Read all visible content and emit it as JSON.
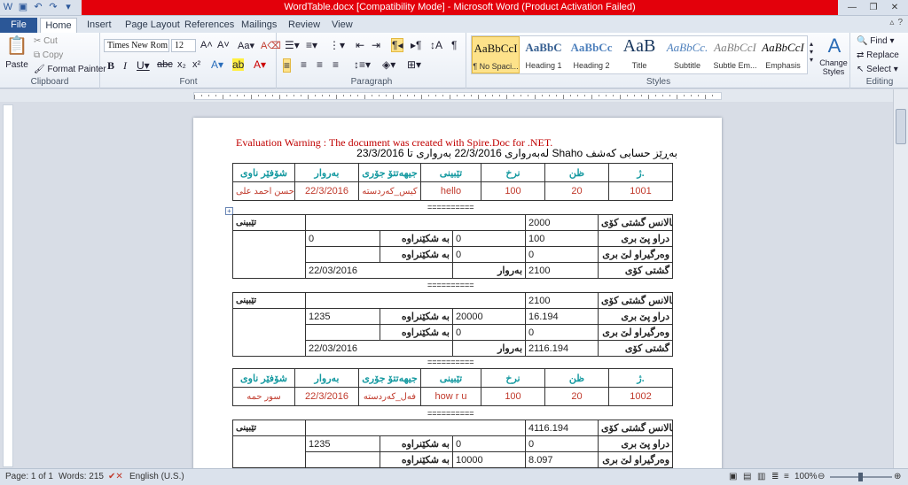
{
  "window": {
    "title": "WordTable.docx [Compatibility Mode] - Microsoft Word (Product Activation Failed)"
  },
  "tabs": [
    "File",
    "Home",
    "Insert",
    "Page Layout",
    "References",
    "Mailings",
    "Review",
    "View"
  ],
  "clipboard": {
    "paste": "Paste",
    "cut": "Cut",
    "copy": "Copy",
    "format_painter": "Format Painter",
    "label": "Clipboard"
  },
  "font": {
    "name": "Times New Rom",
    "size": "12",
    "label": "Font"
  },
  "paragraph": {
    "label": "Paragraph"
  },
  "styles": {
    "label": "Styles",
    "items": [
      {
        "preview": "AaBbCcI",
        "name": "¶ No Spaci..."
      },
      {
        "preview": "AaBbC",
        "name": "Heading 1"
      },
      {
        "preview": "AaBbCc",
        "name": "Heading 2"
      },
      {
        "preview": "AaB",
        "name": "Title"
      },
      {
        "preview": "AaBbCc.",
        "name": "Subtitle"
      },
      {
        "preview": "AaBbCcI",
        "name": "Subtle Em..."
      },
      {
        "preview": "AaBbCcI",
        "name": "Emphasis"
      }
    ],
    "change_styles": "Change Styles"
  },
  "editing": {
    "find": "Find",
    "replace": "Replace",
    "select": "Select",
    "label": "Editing"
  },
  "document": {
    "warning": "Evaluation Warning : The document was created with Spire.Doc for .NET.",
    "header_line": "بەڕێز حسابی کەشف  Shaho  لەبەرواری  22/3/2016  بەرواری تا  23/3/2016",
    "separator": "==========",
    "item_headers": [
      "ژ.",
      "ظن",
      "نرخ",
      "تێبینی",
      "جیهەتتۆ جۆری",
      "بەروار",
      "شۆفێر ناوی"
    ],
    "item1": [
      "1001",
      "20",
      "100",
      "hello",
      "کیس_کەردستە",
      "22/3/2016",
      "حسن احمد علی"
    ],
    "item2": [
      "1002",
      "20",
      "100",
      "how r u",
      "فەل_کەردستە",
      "22/3/2016",
      "سور حمە"
    ],
    "bal_labels": [
      "بالانس گشتی کۆی",
      "دراو پێ بری",
      "وەرگیراو لێ بری",
      "گشتی کۆی"
    ],
    "note": "تێبینی",
    "col_label": "بە شکێنراوە",
    "date_label": "بەروار",
    "bal1": {
      "total": "2000",
      "paid": "100",
      "paid_col": "0",
      "paid_left": "0",
      "recv": "0",
      "recv_col": "0",
      "sum": "2100",
      "date": "22/03/2016"
    },
    "bal2": {
      "total": "2100",
      "paid": "16.194",
      "paid_col": "20000",
      "paid_left": "1235",
      "recv": "0",
      "recv_col": "0",
      "sum": "2116.194",
      "date": "22/03/2016"
    },
    "bal3": {
      "total": "4116.194",
      "paid": "0",
      "paid_col": "0",
      "paid_left": "1235",
      "recv": "8.097",
      "recv_col": "10000"
    }
  },
  "status": {
    "page": "Page: 1 of 1",
    "words": "Words: 215",
    "language": "English (U.S.)",
    "zoom": "100%"
  }
}
